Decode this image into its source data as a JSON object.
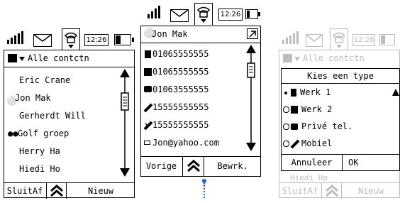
{
  "status": {
    "time": "12:26"
  },
  "screen1": {
    "filter_label": "Alle contctn",
    "contacts": [
      "Eric Crane",
      "Jon Mak",
      "Gerherdt Will",
      "Golf groep",
      "Herry Ha",
      "Hiedi Ho"
    ],
    "softkeys": {
      "left": "SluitAf",
      "right": "Nieuw"
    }
  },
  "screen2": {
    "title": "Jon Mak",
    "details": [
      "01065555555",
      "01065555555",
      "01063555555",
      "15555555555",
      "15555555555",
      "Jon@yahoo.com"
    ],
    "softkeys": {
      "left": "Vorige",
      "right": "Bewrk."
    }
  },
  "screen3": {
    "filter_label": "Alle contctn",
    "popup_title": "Kies een type",
    "types": [
      "Werk 1",
      "Werk 2",
      "Privé tel.",
      "Mobiel"
    ],
    "popup_buttons": {
      "cancel": "Annuleer",
      "ok": "OK"
    },
    "behind_row": "Hiedi Ho",
    "softkeys": {
      "left": "SluitAf",
      "right": "Nieuw"
    }
  },
  "colors": {
    "dim": "#bdbdbd",
    "connector": "#1a5fd6"
  }
}
